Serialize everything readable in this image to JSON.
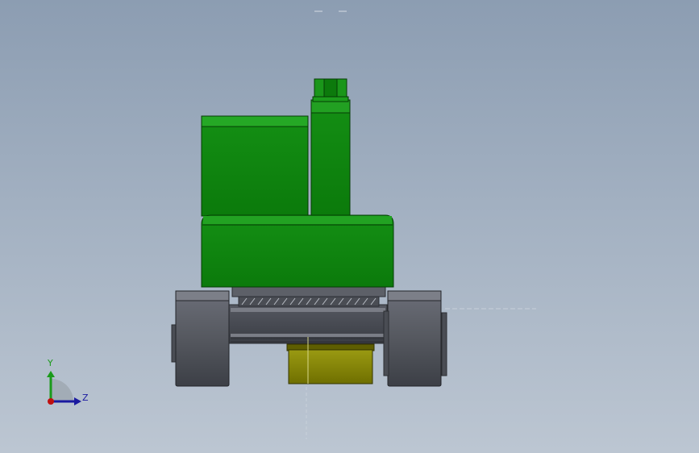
{
  "viewport": {
    "background_top": "#8c9db2",
    "background_bottom": "#bcc6d2"
  },
  "model": {
    "colors": {
      "body_green": "#0e8a0e",
      "body_green_light": "#1fa81f",
      "body_green_dark": "#0a6a0a",
      "bucket_yellow": "#808000",
      "bucket_yellow_light": "#9a9a0a",
      "track_gray": "#5a5d66",
      "track_gray_dark": "#3c3f46"
    }
  },
  "triad": {
    "y_label": "Y",
    "z_label": "Z",
    "y_color": "#1a9a1a",
    "z_color": "#1a1aa0",
    "origin_color": "#c01010"
  }
}
